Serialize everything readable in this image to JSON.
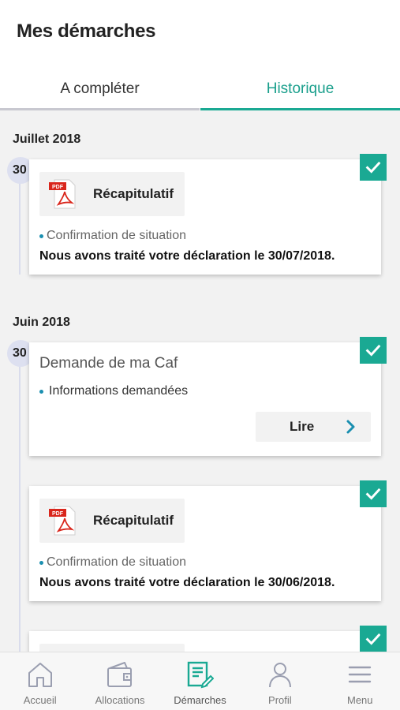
{
  "header": {
    "title": "Mes démarches",
    "tabs": [
      {
        "label": "A compléter"
      },
      {
        "label": "Historique"
      }
    ]
  },
  "timeline": {
    "groups": [
      {
        "month": "Juillet 2018",
        "day": "30",
        "card": {
          "doc_label": "Récapitulatif",
          "bullet": "Confirmation de situation",
          "message": "Nous avons traité votre déclaration le 30/07/2018."
        }
      },
      {
        "month": "Juin 2018",
        "day": "30",
        "card_request": {
          "title": "Demande de ma Caf",
          "bullet": "Informations demandées",
          "button": "Lire"
        },
        "card_doc": {
          "doc_label": "Récapitulatif",
          "bullet": "Confirmation de situation",
          "message": "Nous avons traité votre déclaration le 30/06/2018."
        }
      }
    ]
  },
  "colors": {
    "accent": "#1aa993",
    "timeline": "#d9dcec",
    "bullet": "#1a8fb0",
    "pdf_red": "#d9261c"
  },
  "bottom_nav": {
    "items": [
      {
        "label": "Accueil",
        "icon": "home-icon"
      },
      {
        "label": "Allocations",
        "icon": "wallet-icon"
      },
      {
        "label": "Démarches",
        "icon": "document-edit-icon"
      },
      {
        "label": "Profil",
        "icon": "user-icon"
      },
      {
        "label": "Menu",
        "icon": "menu-icon"
      }
    ],
    "active": "Démarches"
  }
}
